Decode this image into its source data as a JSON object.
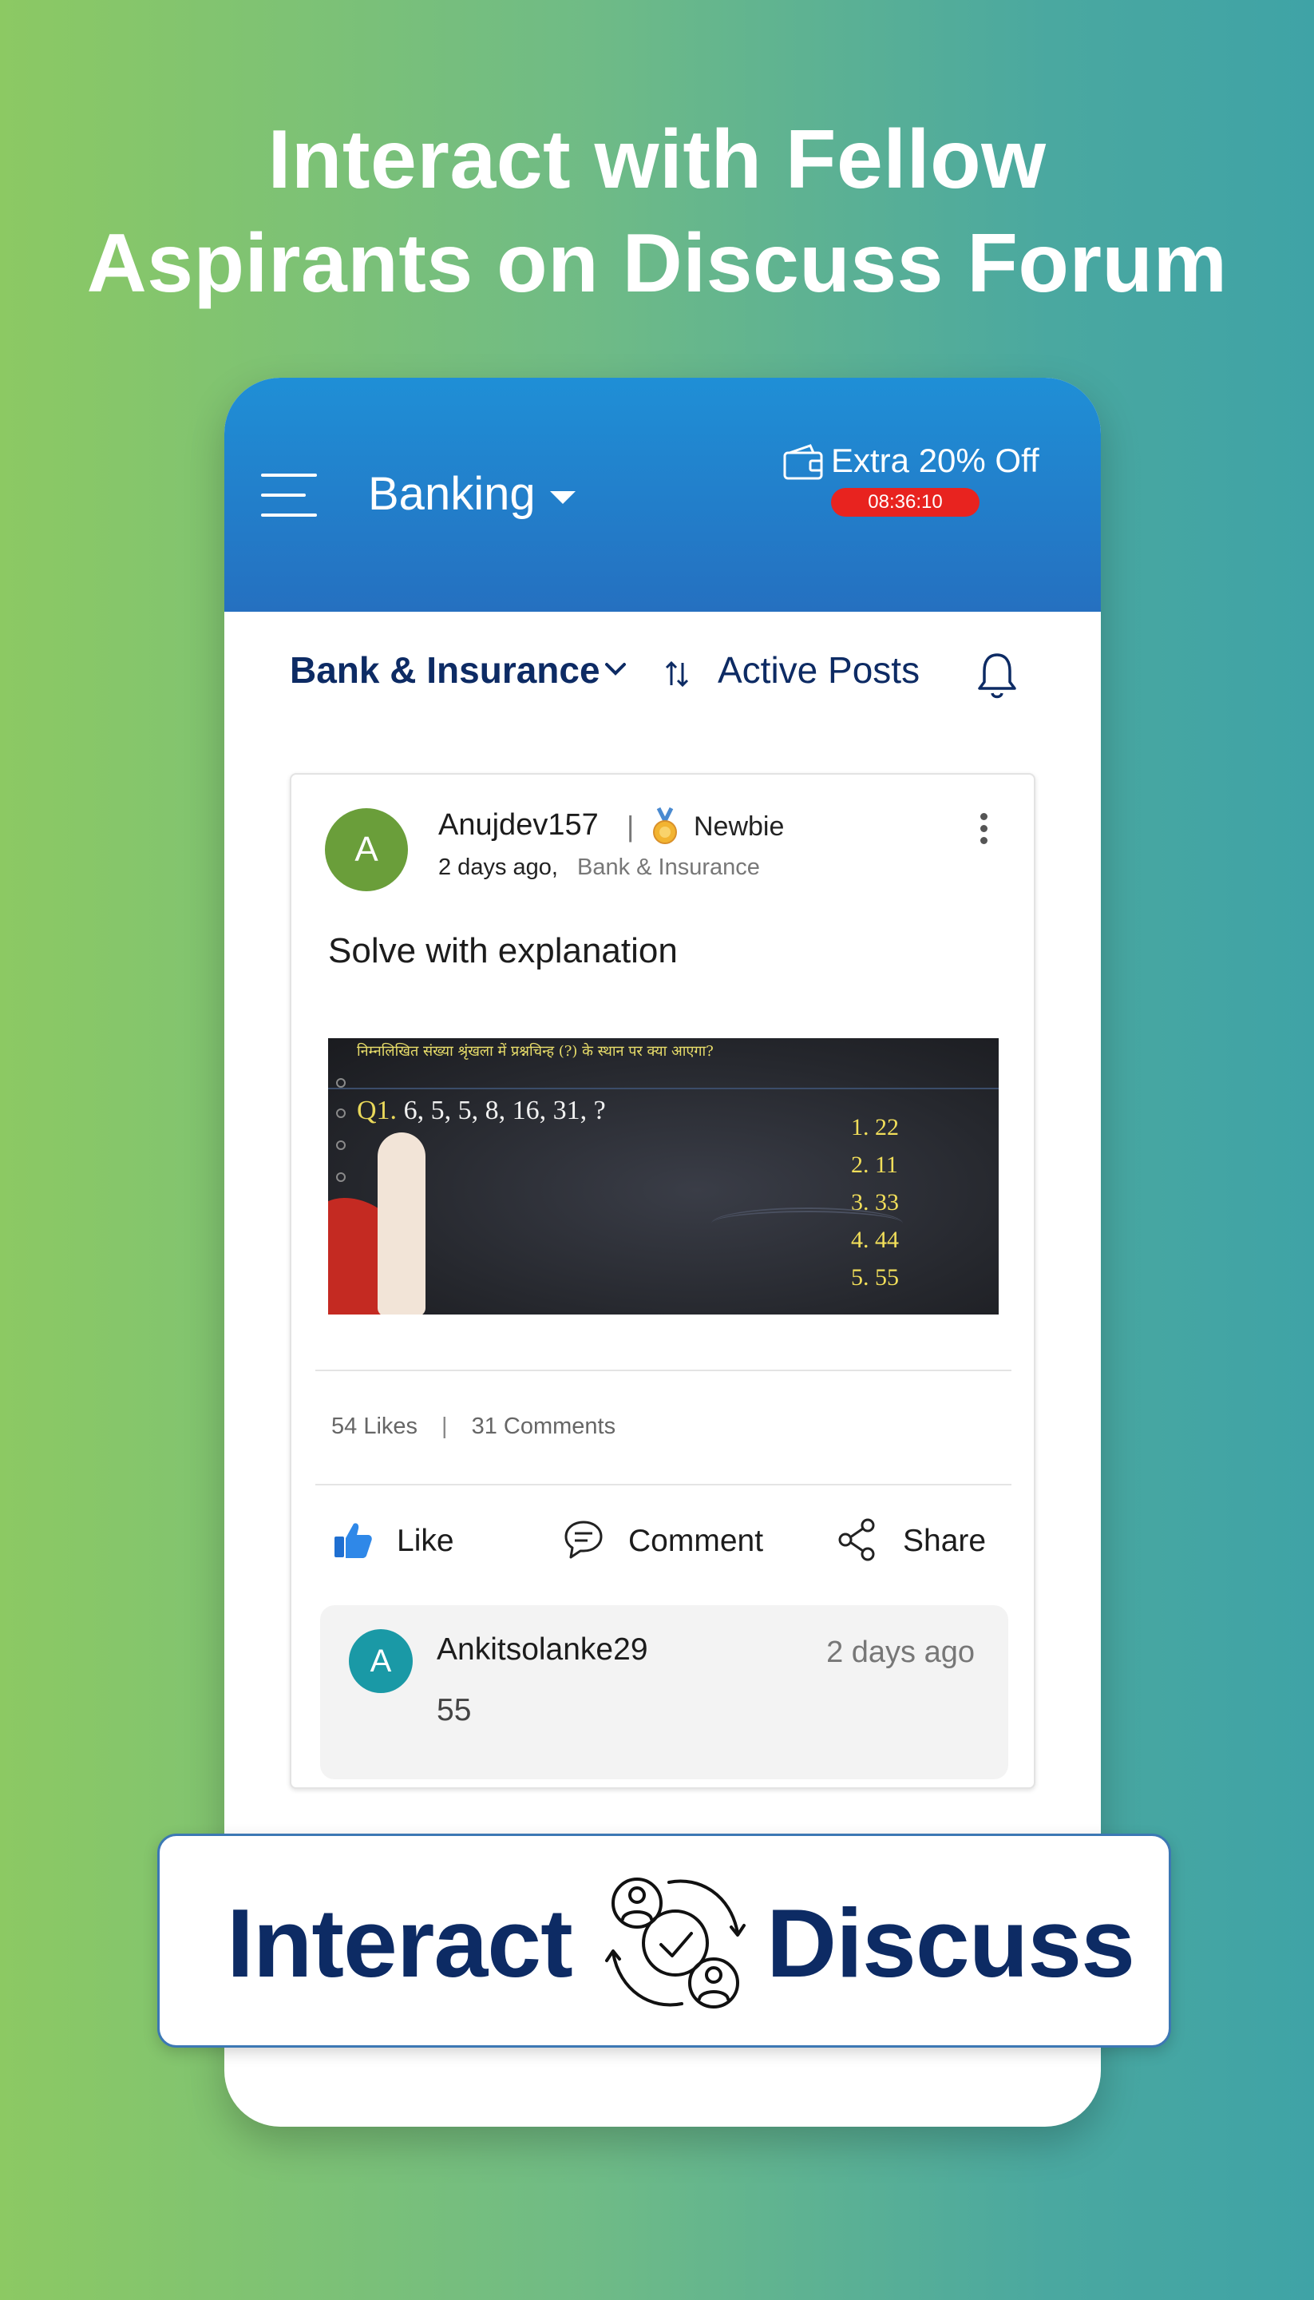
{
  "headline": {
    "line1": "Interact with Fellow",
    "line2": "Aspirants on Discuss Forum"
  },
  "appbar": {
    "title": "Banking",
    "offer_text": "Extra 20% Off",
    "timer": "08:36:10",
    "color": "#2570c0"
  },
  "filters": {
    "category": "Bank & Insurance",
    "sort": "Active Posts"
  },
  "post": {
    "avatar_letter": "A",
    "username": "Anujdev157",
    "separator": "|",
    "rank": "Newbie",
    "time": "2 days ago,",
    "category": "Bank & Insurance",
    "text": "Solve with explanation",
    "image": {
      "hindi_prompt": "निम्नलिखित संख्या श्रृंखला में प्रश्नचिन्ह (?) के स्थान पर क्या आएगा?",
      "question_number": "Q1.",
      "question": " 6, 5, 5, 8, 16, 31, ?",
      "options": [
        "1. 22",
        "2. 11",
        "3. 33",
        "4. 44",
        "5. 55"
      ]
    },
    "likes": "54 Likes",
    "stats_separator": "|",
    "comments": "31 Comments",
    "actions": {
      "like": "Like",
      "comment": "Comment",
      "share": "Share"
    }
  },
  "comment": {
    "avatar_letter": "A",
    "username": "Ankitsolanke29",
    "time": "2 days ago",
    "text": "55"
  },
  "cta": {
    "left": "Interact",
    "right": "Discuss",
    "color": "#0d2b64"
  },
  "icons": [
    "hamburger-icon",
    "caret-down-icon",
    "wallet-icon",
    "chevron-down-icon",
    "sort-icon",
    "bell-icon",
    "medal-icon",
    "more-vertical-icon",
    "thumbs-up-icon",
    "comment-icon",
    "share-icon",
    "discuss-people-icon"
  ]
}
